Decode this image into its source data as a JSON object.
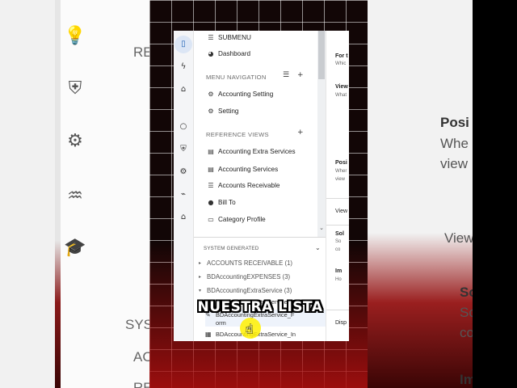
{
  "overlay": {
    "caption": "NUESTRA LISTA"
  },
  "background": {
    "left_texts": [
      "RE",
      "SYS",
      "AC",
      "RE"
    ],
    "right_texts": [
      "Posi",
      "Whe",
      "view",
      "View",
      "So",
      "Sc",
      "co",
      "Im"
    ]
  },
  "rail": {
    "icons": [
      "mobile-icon",
      "lightning-icon",
      "robot-icon",
      "lightbulb-icon",
      "shield-icon",
      "gear-icon",
      "pulse-icon",
      "graduation-icon"
    ]
  },
  "menu": {
    "submenu_label": "SUBMENU",
    "dashboard_label": "Dashboard",
    "nav_section": "MENU NAVIGATION",
    "nav_items": [
      "Accounting Setting",
      "Setting"
    ],
    "ref_section": "REFERENCE VIEWS",
    "ref_items": [
      "Accounting Extra Services",
      "Accounting Services",
      "Accounts Receivable",
      "Bill To",
      "Category Profile"
    ]
  },
  "system_generated": {
    "header": "SYSTEM GENERATED",
    "groups": [
      "ACCOUNTS RECEIVABLE (1)",
      "BDAccountingEXPENSES (3)",
      "BDAccountingExtraService (3)"
    ],
    "leaves": [
      "BDAccountingExtraService_D",
      "BDAccountingExtraService_F",
      "orm",
      "BDAccountingExtraService_In"
    ]
  },
  "right_panel": {
    "items": [
      {
        "title": "For t",
        "sub": "Whic"
      },
      {
        "title": "View",
        "sub": "What"
      },
      {
        "title": "Posi",
        "sub": "Wher"
      },
      {
        "title": "",
        "sub": "view"
      },
      {
        "title": "View",
        "sub": ""
      },
      {
        "title": "Sol",
        "sub": "So"
      },
      {
        "title": "",
        "sub": "co"
      },
      {
        "title": "Im",
        "sub": "Ho"
      },
      {
        "title": "Disp",
        "sub": ""
      }
    ]
  }
}
